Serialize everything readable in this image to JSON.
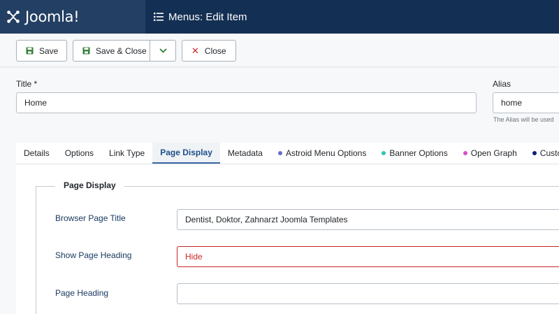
{
  "header": {
    "logo_text": "Joomla!",
    "page_title": "Menus: Edit Item"
  },
  "toolbar": {
    "save_label": "Save",
    "save_close_label": "Save & Close",
    "close_label": "Close"
  },
  "form": {
    "title_label": "Title *",
    "title_value": "Home",
    "alias_label": "Alias",
    "alias_value": "home",
    "alias_hint": "The Alias will be used"
  },
  "tabs": [
    {
      "label": "Details"
    },
    {
      "label": "Options"
    },
    {
      "label": "Link Type"
    },
    {
      "label": "Page Display",
      "active": true
    },
    {
      "label": "Metadata"
    },
    {
      "label": "Astroid Menu Options",
      "dot_color": "#6c6bc4"
    },
    {
      "label": "Banner Options",
      "dot_color": "#2ec4b6"
    },
    {
      "label": "Open Graph",
      "dot_color": "#d94fc8"
    },
    {
      "label": "Custom C",
      "dot_color": "#0b1f7a"
    }
  ],
  "page_display": {
    "legend": "Page Display",
    "browser_title_label": "Browser Page Title",
    "browser_title_value": "Dentist, Doktor, Zahnarzt Joomla Templates",
    "show_heading_label": "Show Page Heading",
    "show_heading_value": "Hide",
    "page_heading_label": "Page Heading",
    "page_heading_value": ""
  },
  "colors": {
    "header_bg": "#132f53",
    "logo_bg": "#233f63",
    "save_icon": "#2f7d32",
    "close_icon": "#c52827",
    "active_tab": "#1e4f8a",
    "invalid": "#c52827"
  }
}
